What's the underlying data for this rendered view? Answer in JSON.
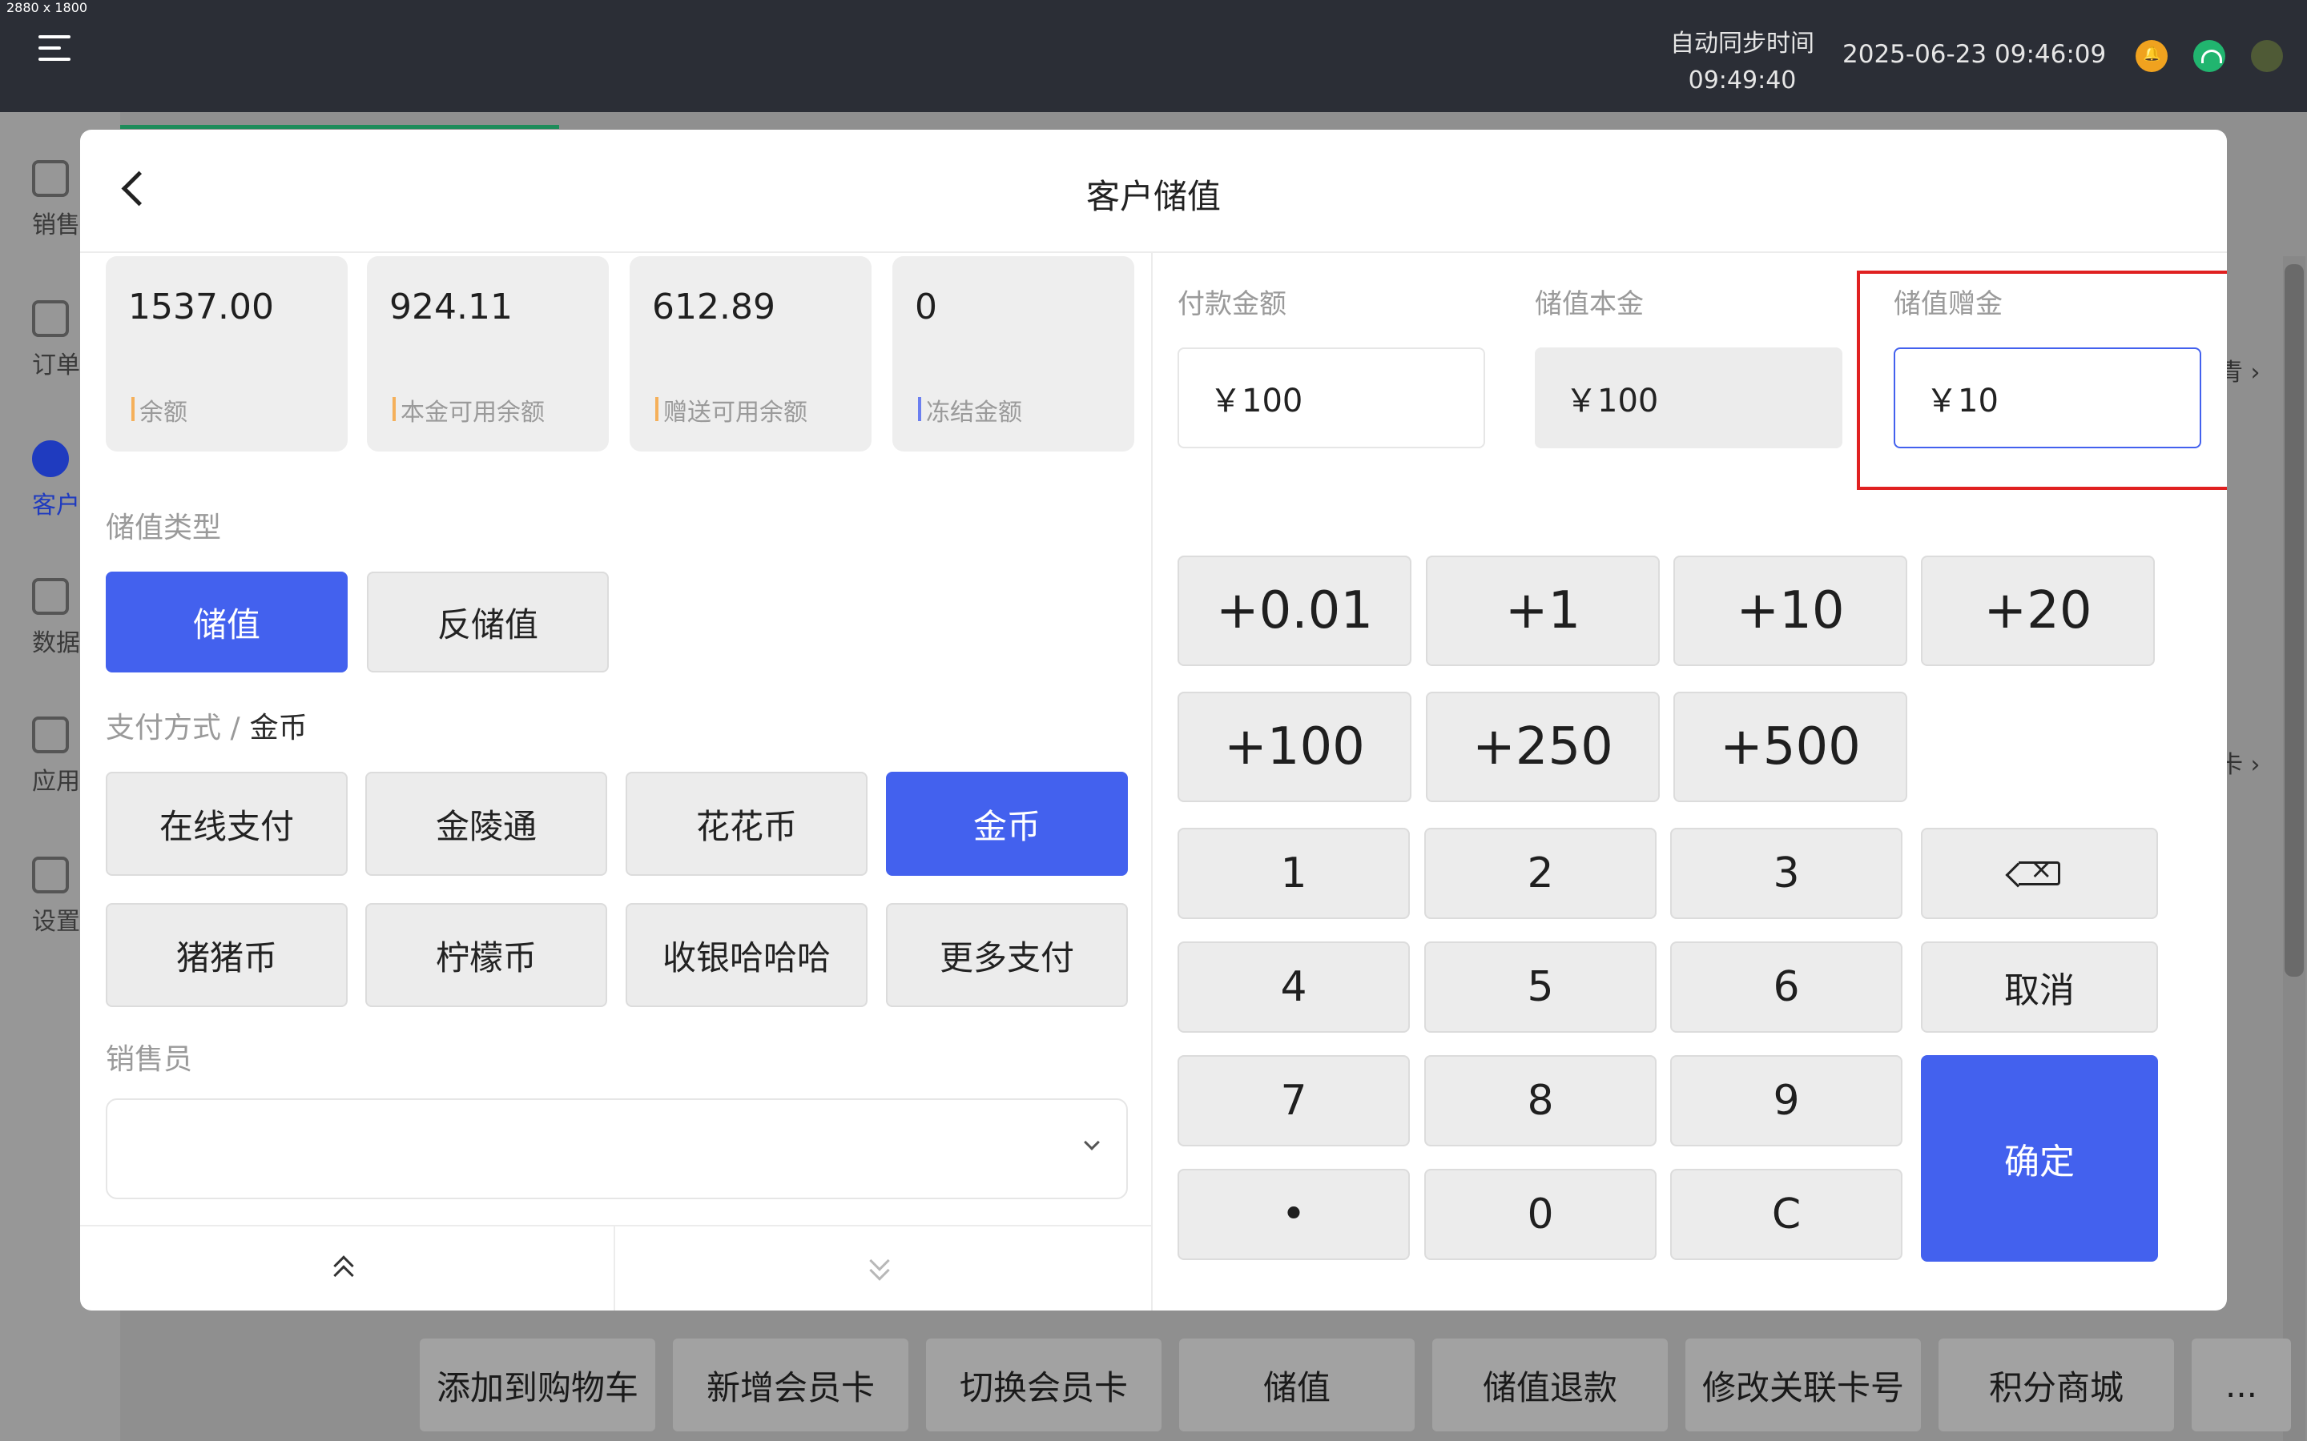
{
  "screen": {
    "dimension_label": "2880 x 1800"
  },
  "topbar": {
    "sync_label": "自动同步时间",
    "sync_time": "09:49:40",
    "datetime": "2025-06-23 09:46:09"
  },
  "sidebar": {
    "items": [
      {
        "label": "销售",
        "icon": "cart-icon"
      },
      {
        "label": "订单",
        "icon": "clipboard-icon"
      },
      {
        "label": "客户",
        "icon": "users-icon",
        "active": true
      },
      {
        "label": "数据",
        "icon": "user-chart-icon"
      },
      {
        "label": "应用",
        "icon": "apps-icon"
      },
      {
        "label": "设置",
        "icon": "gear-icon"
      }
    ]
  },
  "background": {
    "right_fragments": [
      "青 ›",
      "卡 ›"
    ],
    "bottom_actions": [
      "添加到购物车",
      "新增会员卡",
      "切换会员卡",
      "储值",
      "储值退款",
      "修改关联卡号",
      "积分商城",
      "..."
    ]
  },
  "modal": {
    "title": "客户储值",
    "stats": [
      {
        "value": "1537.00",
        "label": "余额",
        "bar_color": "#f5b05a"
      },
      {
        "value": "924.11",
        "label": "本金可用余额",
        "bar_color": "#f5b05a"
      },
      {
        "value": "612.89",
        "label": "赠送可用余额",
        "bar_color": "#f5b05a"
      },
      {
        "value": "0",
        "label": "冻结金额",
        "bar_color": "#6b7ff0"
      }
    ],
    "type_section": {
      "label": "储值类型",
      "options": [
        {
          "label": "储值",
          "selected": true
        },
        {
          "label": "反储值",
          "selected": false
        }
      ]
    },
    "payment_section": {
      "label": "支付方式 /",
      "current": "金币",
      "options": [
        {
          "label": "在线支付",
          "selected": false
        },
        {
          "label": "金陵通",
          "selected": false
        },
        {
          "label": "花花币",
          "selected": false
        },
        {
          "label": "金币",
          "selected": true
        },
        {
          "label": "猪猪币",
          "selected": false
        },
        {
          "label": "柠檬币",
          "selected": false
        },
        {
          "label": "收银哈哈哈",
          "selected": false
        },
        {
          "label": "更多支付",
          "selected": false
        }
      ]
    },
    "salesperson": {
      "label": "销售员",
      "value": ""
    },
    "fields": {
      "pay_amount": {
        "label": "付款金额",
        "value": "￥100"
      },
      "base_amount": {
        "label": "储值本金",
        "value": "￥100"
      },
      "gift_amount": {
        "label": "储值赠金",
        "value": "￥10"
      }
    },
    "quick_add": [
      "+0.01",
      "+1",
      "+10",
      "+20",
      "+100",
      "+250",
      "+500"
    ],
    "keypad": {
      "digits": [
        "1",
        "2",
        "3",
        "4",
        "5",
        "6",
        "7",
        "8",
        "9",
        "•",
        "0",
        "C"
      ],
      "cancel": "取消",
      "confirm": "确定"
    }
  }
}
